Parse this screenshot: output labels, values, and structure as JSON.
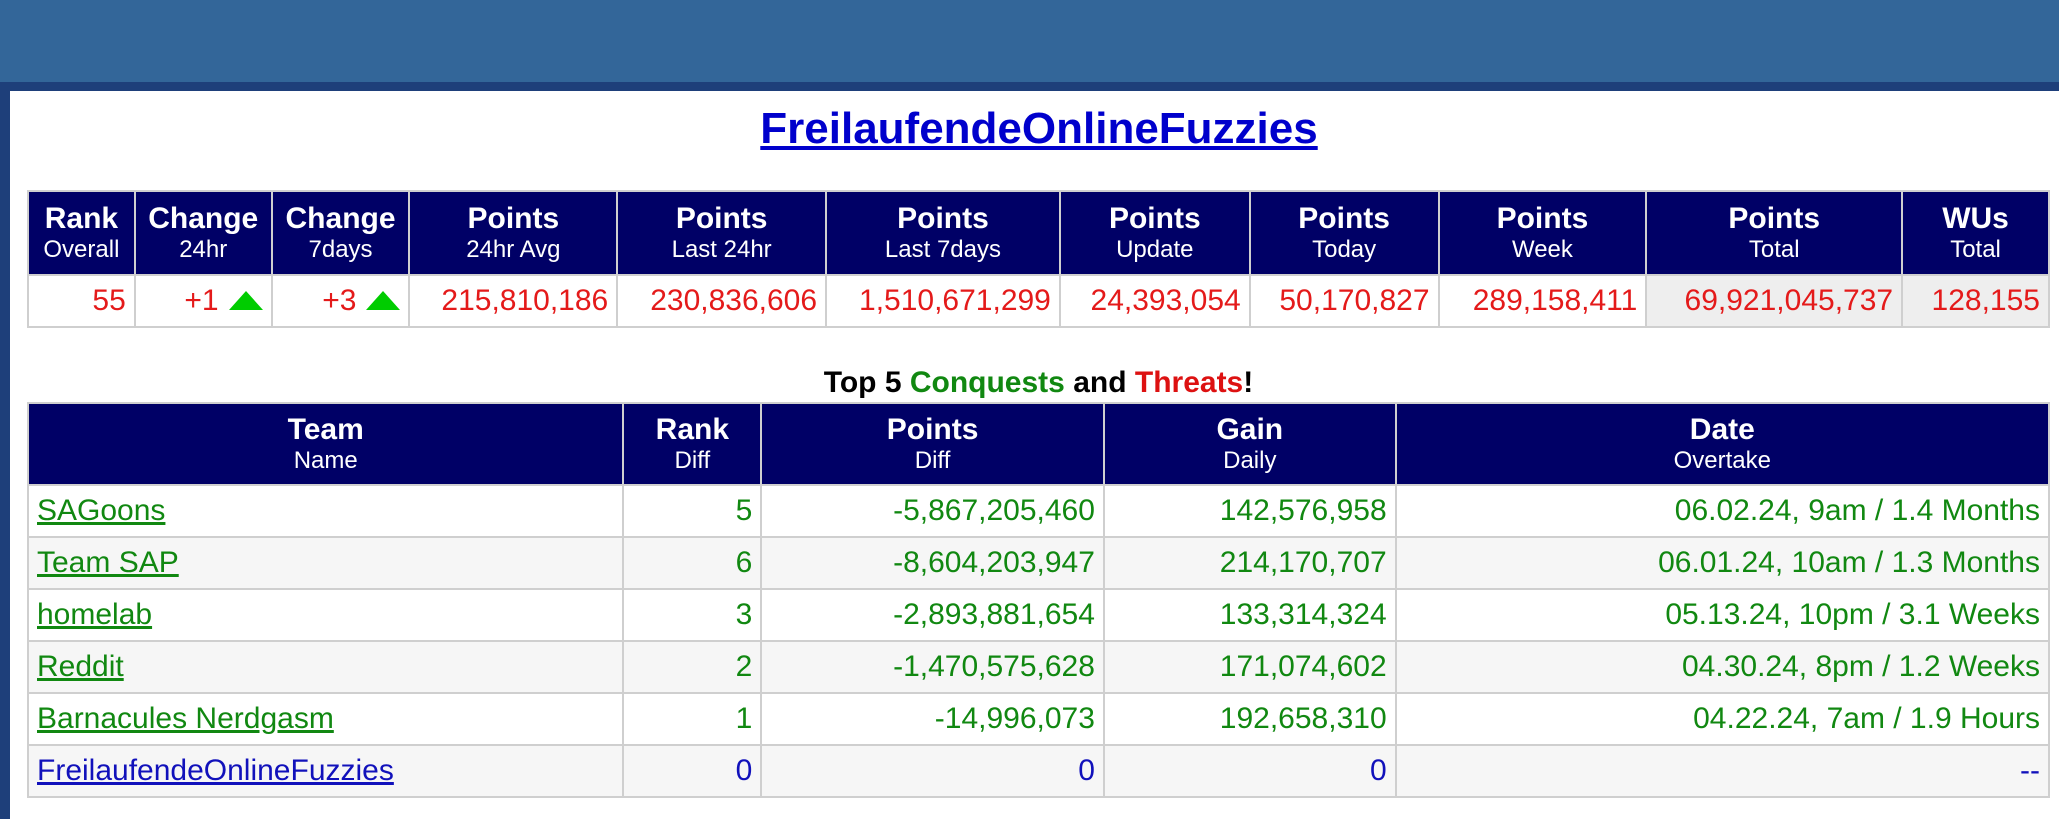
{
  "team_name": "FreilaufendeOnlineFuzzies",
  "summary": {
    "headers": [
      {
        "top": "Rank",
        "bottom": "Overall"
      },
      {
        "top": "Change",
        "bottom": "24hr"
      },
      {
        "top": "Change",
        "bottom": "7days"
      },
      {
        "top": "Points",
        "bottom": "24hr Avg"
      },
      {
        "top": "Points",
        "bottom": "Last 24hr"
      },
      {
        "top": "Points",
        "bottom": "Last 7days"
      },
      {
        "top": "Points",
        "bottom": "Update"
      },
      {
        "top": "Points",
        "bottom": "Today"
      },
      {
        "top": "Points",
        "bottom": "Week"
      },
      {
        "top": "Points",
        "bottom": "Total"
      },
      {
        "top": "WUs",
        "bottom": "Total"
      }
    ],
    "values": {
      "rank_overall": "55",
      "change_24hr": "+1",
      "change_7days": "+3",
      "points_24hr_avg": "215,810,186",
      "points_last_24hr": "230,836,606",
      "points_last_7days": "1,510,671,299",
      "points_update": "24,393,054",
      "points_today": "50,170,827",
      "points_week": "289,158,411",
      "points_total": "69,921,045,737",
      "wus_total": "128,155"
    },
    "change_icon": "up-arrow-icon",
    "change_icon_color": "#00cc00"
  },
  "section": {
    "prefix": "Top 5 ",
    "conquests": "Conquests",
    "and": " and ",
    "threats": "Threats",
    "suffix": "!"
  },
  "conquests": {
    "headers": [
      {
        "top": "Team",
        "bottom": "Name"
      },
      {
        "top": "Rank",
        "bottom": "Diff"
      },
      {
        "top": "Points",
        "bottom": "Diff"
      },
      {
        "top": "Gain",
        "bottom": "Daily"
      },
      {
        "top": "Date",
        "bottom": "Overtake"
      }
    ],
    "rows": [
      {
        "name": "SAGoons",
        "rank_diff": "5",
        "points_diff": "-5,867,205,460",
        "gain_daily": "142,576,958",
        "overtake": "06.02.24, 9am / 1.4 Months"
      },
      {
        "name": "Team SAP",
        "rank_diff": "6",
        "points_diff": "-8,604,203,947",
        "gain_daily": "214,170,707",
        "overtake": "06.01.24, 10am / 1.3 Months"
      },
      {
        "name": "homelab",
        "rank_diff": "3",
        "points_diff": "-2,893,881,654",
        "gain_daily": "133,314,324",
        "overtake": "05.13.24, 10pm / 3.1 Weeks"
      },
      {
        "name": "Reddit",
        "rank_diff": "2",
        "points_diff": "-1,470,575,628",
        "gain_daily": "171,074,602",
        "overtake": "04.30.24, 8pm / 1.2 Weeks"
      },
      {
        "name": "Barnacules Nerdgasm",
        "rank_diff": "1",
        "points_diff": "-14,996,073",
        "gain_daily": "192,658,310",
        "overtake": "04.22.24, 7am / 1.9 Hours"
      },
      {
        "name": "FreilaufendeOnlineFuzzies",
        "rank_diff": "0",
        "points_diff": "0",
        "gain_daily": "0",
        "overtake": "--"
      }
    ]
  },
  "colors": {
    "banner": "#336699",
    "header_bg": "#000066",
    "value_red": "#e41a1a",
    "conquest_green": "#118811",
    "self_blue": "#1111bb"
  }
}
